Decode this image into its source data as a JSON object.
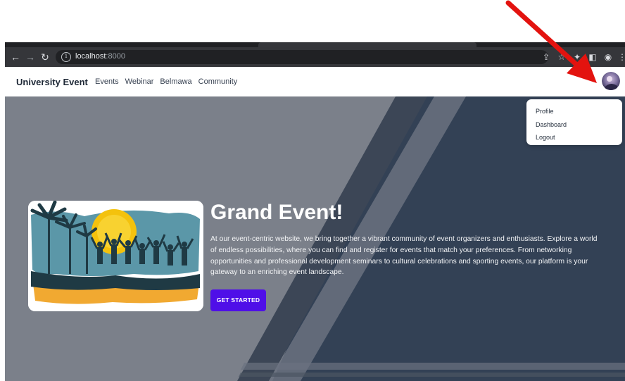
{
  "browser": {
    "url_host": "localhost",
    "url_port": ":8000",
    "back_icon": "arrow-left-icon",
    "forward_icon": "arrow-right-icon",
    "reload_icon": "reload-icon",
    "info_glyph": "i"
  },
  "navbar": {
    "brand": "University Event",
    "links": [
      "Events",
      "Webinar",
      "Belmawa",
      "Community"
    ]
  },
  "dropdown": {
    "items": [
      "Profile",
      "Dashboard",
      "Logout"
    ]
  },
  "hero": {
    "title": "Grand Event!",
    "description": "At our event-centric website, we bring together a vibrant community of event organizers and enthusiasts. Explore a world of endless possibilities, where you can find and register for events that match your preferences. From networking opportunities and professional development seminars to cultural celebrations and sporting events, our platform is your gateway to an enriching event landscape.",
    "cta_label": "GET STARTED"
  },
  "colors": {
    "hero_base": "#7b808a",
    "hero_dark": "#334155",
    "cta": "#4f0fe8",
    "annotation_arrow": "#e3130f"
  }
}
